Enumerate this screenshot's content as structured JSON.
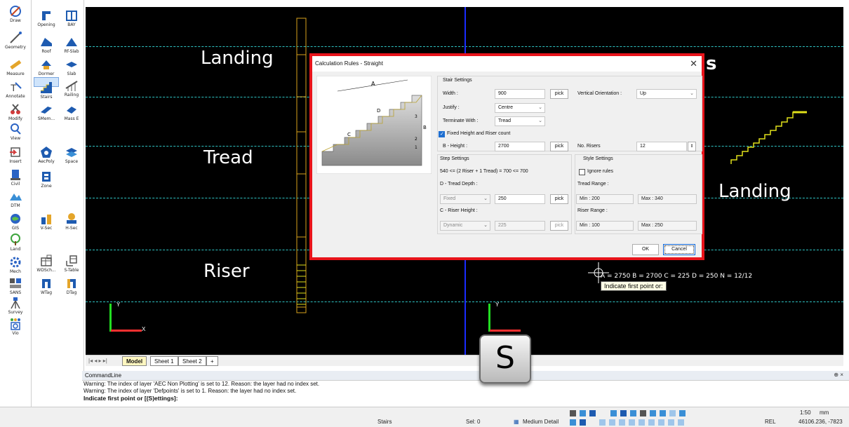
{
  "left_tools": [
    {
      "name": "draw",
      "label": "Draw"
    },
    {
      "name": "geometry",
      "label": "Geometry"
    },
    {
      "name": "measure",
      "label": "Measure"
    },
    {
      "name": "annotate",
      "label": "Annotate"
    },
    {
      "name": "modify",
      "label": "Modify"
    },
    {
      "name": "view",
      "label": "View"
    },
    {
      "name": "insert",
      "label": "Insert"
    },
    {
      "name": "civil",
      "label": "Civil"
    },
    {
      "name": "dtm",
      "label": "DTM"
    },
    {
      "name": "gis",
      "label": "GIS"
    },
    {
      "name": "land",
      "label": "Land"
    },
    {
      "name": "mech",
      "label": "Mech"
    },
    {
      "name": "sans",
      "label": "SANS"
    },
    {
      "name": "survey",
      "label": "Survey"
    },
    {
      "name": "vio",
      "label": "Vio"
    }
  ],
  "arch_tools": [
    {
      "name": "opening",
      "label": "Opening"
    },
    {
      "name": "bay",
      "label": "BAY"
    },
    {
      "name": "roof",
      "label": "Roof"
    },
    {
      "name": "rf-slab",
      "label": "Rf-Slab"
    },
    {
      "name": "dormer",
      "label": "Dormer"
    },
    {
      "name": "slab",
      "label": "Slab"
    },
    {
      "name": "stairs",
      "label": "Stairs"
    },
    {
      "name": "railing",
      "label": "Railing"
    },
    {
      "name": "smem",
      "label": "SMem..."
    },
    {
      "name": "mass-e",
      "label": "Mass E"
    },
    {
      "name": "aecpoly",
      "label": "AecPoly"
    },
    {
      "name": "space",
      "label": "Space"
    },
    {
      "name": "zone",
      "label": "Zone"
    },
    {
      "name": "v-sec",
      "label": "V-Sec"
    },
    {
      "name": "h-sec",
      "label": "H-Sec"
    },
    {
      "name": "wdsch",
      "label": "WDSch..."
    },
    {
      "name": "s-table",
      "label": "S-Table"
    },
    {
      "name": "wtag",
      "label": "WTag"
    },
    {
      "name": "dtag",
      "label": "DTag"
    }
  ],
  "canvas": {
    "labels_left": [
      "Landing",
      "Tread",
      "Riser"
    ],
    "label_right": "Landing",
    "label_section_partial": "s",
    "stair_info": "A = 2750  B = 2700  C = 225  D = 250  N = 12/12",
    "tooltip": "Indicate first point or:",
    "ucs_y": "Y",
    "ucs_x": "X"
  },
  "dialog": {
    "title": "Calculation Rules - Straight",
    "stair_settings_header": "Stair Settings",
    "width_label": "Width :",
    "width_value": "900",
    "pick": "pick",
    "vertical_orientation_label": "Vertical Orientation :",
    "vertical_orientation_value": "Up",
    "justify_label": "Justify :",
    "justify_value": "Centre",
    "terminate_label": "Terminate With :",
    "terminate_value": "Tread",
    "fixed_height_label": "Fixed Height and Riser count",
    "b_height_label": "B - Height :",
    "b_height_value": "2700",
    "no_risers_label": "No. Risers",
    "no_risers_value": "12",
    "step_settings_header": "Step Settings",
    "step_formula": "540 <= (2 Riser + 1 Tread) = 700 <= 700",
    "tread_depth_label": "D - Tread Depth :",
    "tread_depth_mode": "Fixed",
    "tread_depth_value": "250",
    "riser_height_label": "C - Riser Height :",
    "riser_height_mode": "Dynamic",
    "riser_height_value": "225",
    "style_settings_header": "Style Settings",
    "ignore_rules_label": "Ignore rules",
    "tread_range_label": "Tread Range :",
    "tread_min": "Min :  200",
    "tread_max": "Max :  340",
    "riser_range_label": "Riser Range :",
    "riser_min": "Min :  100",
    "riser_max": "Max :  250",
    "ok": "OK",
    "cancel": "Cancel",
    "diagram_labels": {
      "a": "A",
      "b": "B",
      "c": "C",
      "d": "D",
      "n1": "1",
      "n2": "2",
      "n3": "3"
    }
  },
  "tabs": {
    "nav": "|◂ ◂ ▸ ▸|",
    "items": [
      "Model",
      "Sheet 1",
      "Sheet 2",
      "+"
    ]
  },
  "command": {
    "header": "CommandLine",
    "pin": "⊕ ×",
    "lines": [
      "Warning: The index of layer 'AEC Non Plotting' is set to 12. Reason: the layer had no index set.",
      "Warning: The index of layer 'Defpoints' is set to 1. Reason: the layer had no index set."
    ],
    "prompt": "Indicate first point or [(S)ettings]:"
  },
  "status": {
    "command_name": "Stairs",
    "selection": "Sel: 0",
    "detail": "Medium Detail",
    "ref": "REL",
    "scale": "1:50",
    "units": "mm",
    "coords": "46106.236, -7823"
  },
  "overlay_key": "S",
  "colors": {
    "canvas": "#000000",
    "dialog_border": "#e8141b",
    "guide": "#2fc4c4",
    "stair_yellow": "#e0e01a",
    "split": "#1a2cff"
  }
}
